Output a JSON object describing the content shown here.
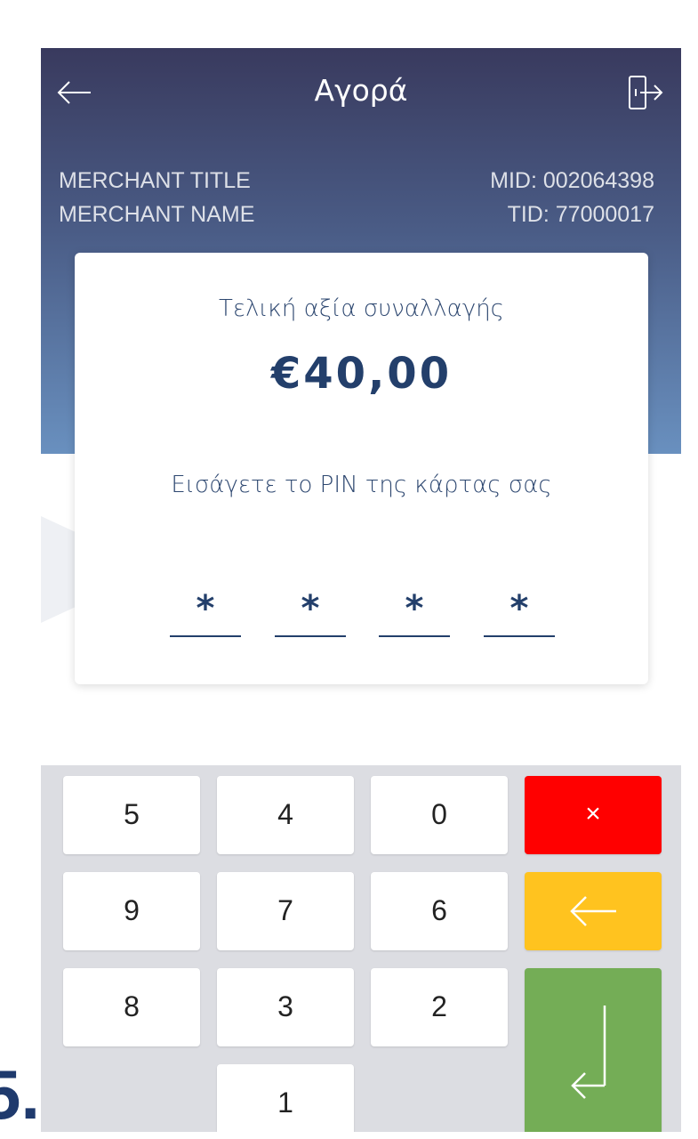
{
  "header": {
    "title": "Αγορά",
    "merchant_title": "MERCHANT TITLE",
    "merchant_name": "MERCHANT NAME",
    "mid": "MID: 002064398",
    "tid": "TID: 77000017"
  },
  "card": {
    "amount_label": "Τελική αξία συναλλαγής",
    "amount_value": "€40,00",
    "pin_label": "Εισάγετε το PIN της κάρτας σας",
    "pin_digits": [
      "*",
      "*",
      "*",
      "*"
    ]
  },
  "keypad": {
    "rows": [
      [
        "5",
        "4",
        "0"
      ],
      [
        "9",
        "7",
        "6"
      ],
      [
        "8",
        "3",
        "2"
      ],
      [
        "1"
      ]
    ],
    "cancel_label": "×",
    "backspace_icon": "arrow-left-icon",
    "enter_icon": "enter-return-icon",
    "colors": {
      "cancel": "#ff0000",
      "backspace": "#ffc31f",
      "enter": "#74ad56"
    }
  },
  "caption": "5.",
  "colors": {
    "header_top": "#393a5e",
    "header_bottom": "#6990bf",
    "accent_text": "#233f6b"
  }
}
